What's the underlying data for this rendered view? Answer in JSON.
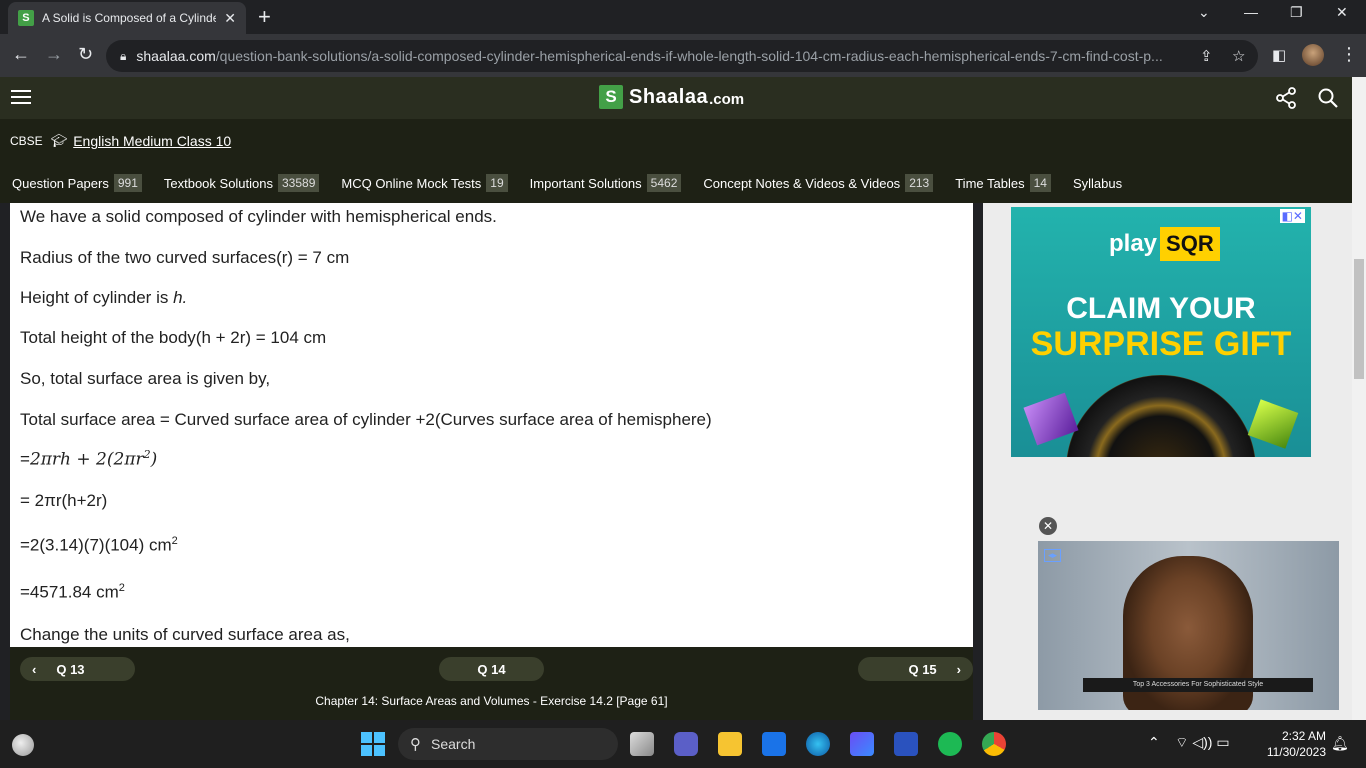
{
  "browser": {
    "tab_title": "A Solid is Composed of a Cylinder",
    "tab_favicon": "S",
    "url_host": "shaalaa.com",
    "url_path": "/question-bank-solutions/a-solid-composed-cylinder-hemispherical-ends-if-whole-length-solid-104-cm-radius-each-hemispherical-ends-7-cm-find-cost-p...",
    "new_tab": "+",
    "close_tab": "✕"
  },
  "site": {
    "logo_letter": "S",
    "logo_text": "Shaalaa",
    "logo_domain": ".com",
    "board": "CBSE",
    "class_name": "English Medium Class 10",
    "nav": [
      {
        "label": "Question Papers",
        "count": "991"
      },
      {
        "label": "Textbook Solutions",
        "count": "33589"
      },
      {
        "label": "MCQ Online Mock Tests",
        "count": "19"
      },
      {
        "label": "Important Solutions",
        "count": "5462"
      },
      {
        "label": "Concept Notes & Videos & Videos",
        "count": "213"
      },
      {
        "label": "Time Tables",
        "count": "14"
      },
      {
        "label": "Syllabus",
        "count": ""
      }
    ]
  },
  "solution": {
    "line1": "We have a solid composed of cylinder with hemispherical ends.",
    "line2": "Radius of the two curved surfaces(r) = 7 cm",
    "line3_a": "Height of cylinder is ",
    "line3_b": "h.",
    "line4": "Total height of the body(h + 2r) = 104 cm",
    "line5": "So, total surface area is given by,",
    "line6": "Total surface area = Curved surface area of cylinder +2(Curves surface area of hemisphere)",
    "line7_prefix": "=",
    "line7_math": "2πrh + 2(2πr",
    "line7_sup": "2",
    "line7_end": ")",
    "line8": "= 2πr(h+2r)",
    "line9": "=2(3.14)(7)(104) cm",
    "line9_sup": "2",
    "line10": "=4571.84 cm",
    "line10_sup": "2",
    "line11": "Change the units of curved surface area as,"
  },
  "question_nav": {
    "prev": "Q 13",
    "current": "Q 14",
    "next": "Q 15",
    "chapter": "Chapter 14: Surface Areas and Volumes - Exercise 14.2 [Page 61]"
  },
  "ad": {
    "brand_play": "play",
    "brand_sqr": "SQR",
    "line1": "CLAIM YOUR",
    "line2": "SURPRISE GIFT"
  },
  "video_ad": {
    "caption": "Top 3 Accessories For Sophisticated Style"
  },
  "taskbar": {
    "search_label": "Search",
    "time": "2:32 AM",
    "date": "11/30/2023"
  },
  "colors": {
    "site_green": "#43a047",
    "header_bg": "#2a2e20",
    "nav_bg": "#1e2115",
    "ad_teal": "#23b3ad",
    "ad_yellow": "#ffd000"
  }
}
